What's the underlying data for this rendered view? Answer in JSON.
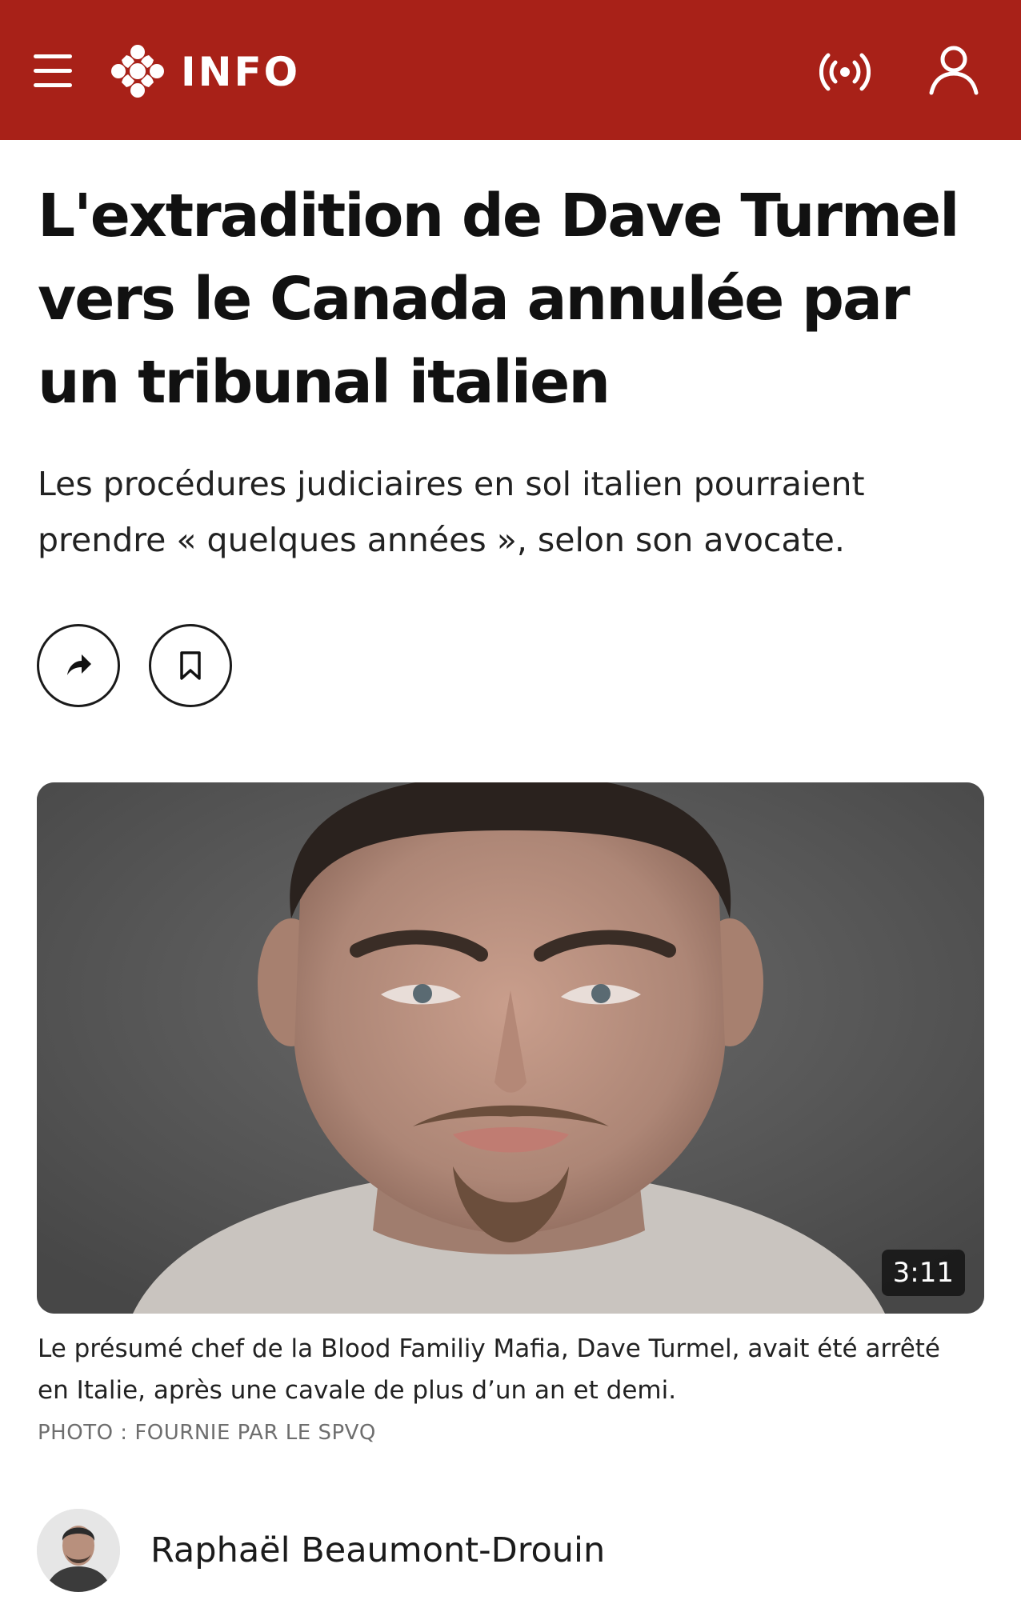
{
  "header": {
    "brand_label": "INFO",
    "menu_icon": "hamburger-menu-icon",
    "logo_icon": "cbc-gem-logo",
    "live_icon": "live-broadcast-icon",
    "profile_icon": "user-profile-icon",
    "background_color": "#a82118"
  },
  "article": {
    "headline": "L'extradition de Dave Turmel vers le Canada annulée par un tribunal italien",
    "subheadline": "Les procédures judiciaires en sol italien pourraient prendre « quelques années », selon son avocate.",
    "actions": {
      "share_icon": "share-arrow-icon",
      "bookmark_icon": "bookmark-icon"
    },
    "media": {
      "duration": "3:11",
      "caption": "Le présumé chef de la Blood Familiy Mafia, Dave Turmel, avait été arrêté en Italie, après une cavale de plus d’un an et demi.",
      "credit": "PHOTO : FOURNIE PAR LE SPVQ"
    },
    "author": {
      "name": "Raphaël Beaumont-Drouin"
    }
  }
}
